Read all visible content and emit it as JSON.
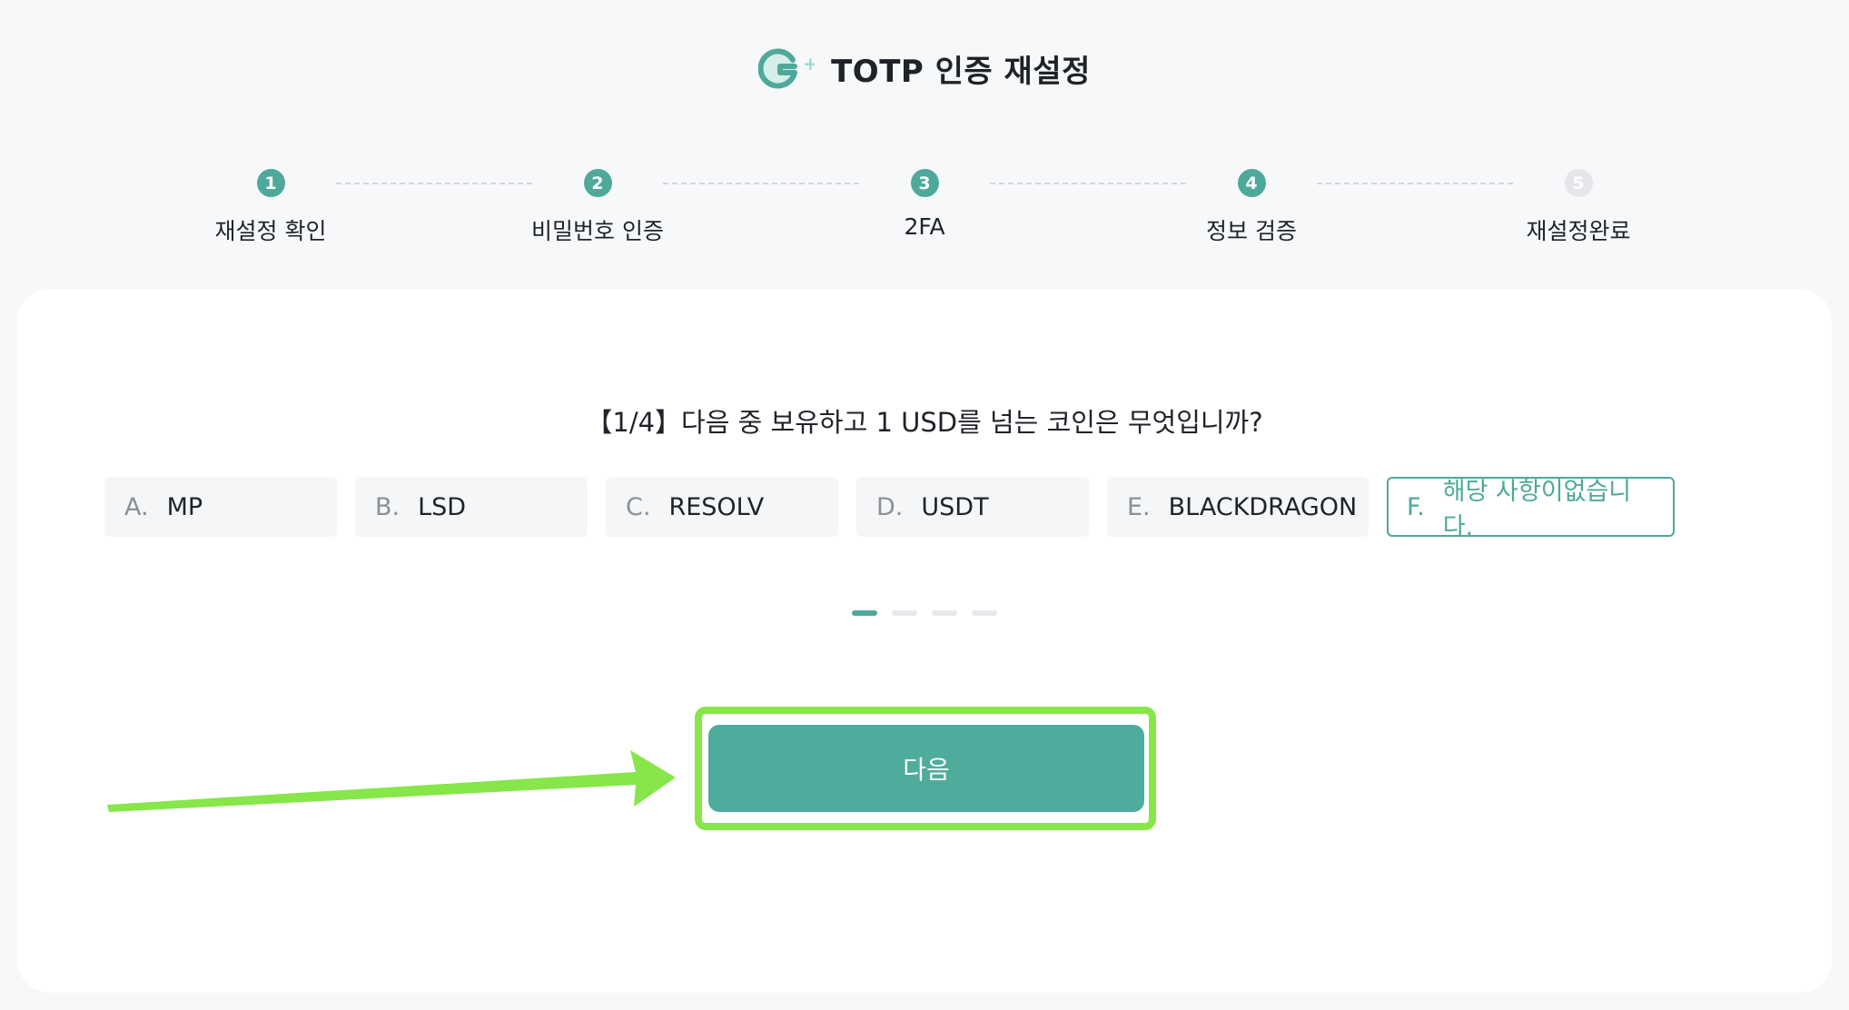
{
  "header": {
    "title": "TOTP 인증 재설정",
    "logo_plus": "+"
  },
  "stepper": {
    "steps": [
      {
        "number": "1",
        "label": "재설정 확인",
        "state": "done"
      },
      {
        "number": "2",
        "label": "비밀번호 인증",
        "state": "done"
      },
      {
        "number": "3",
        "label": "2FA",
        "state": "done"
      },
      {
        "number": "4",
        "label": "정보 검증",
        "state": "done"
      },
      {
        "number": "5",
        "label": "재설정완료",
        "state": "todo"
      }
    ]
  },
  "question": {
    "text": "【1/4】다음 중 보유하고 1 USD를 넘는 코인은 무엇입니까?",
    "options": [
      {
        "letter": "A.",
        "text": "MP"
      },
      {
        "letter": "B.",
        "text": "LSD"
      },
      {
        "letter": "C.",
        "text": "RESOLV"
      },
      {
        "letter": "D.",
        "text": "USDT"
      },
      {
        "letter": "E.",
        "text": "BLACKDRAGON"
      },
      {
        "letter": "F.",
        "text": "해당 사항이없습니다.",
        "selected": true
      }
    ]
  },
  "pager": {
    "total": 4,
    "current": 1
  },
  "actions": {
    "next_label": "다음"
  },
  "colors": {
    "accent": "#4ea99a",
    "highlight": "#86e64a",
    "background": "#f7f8fa"
  }
}
